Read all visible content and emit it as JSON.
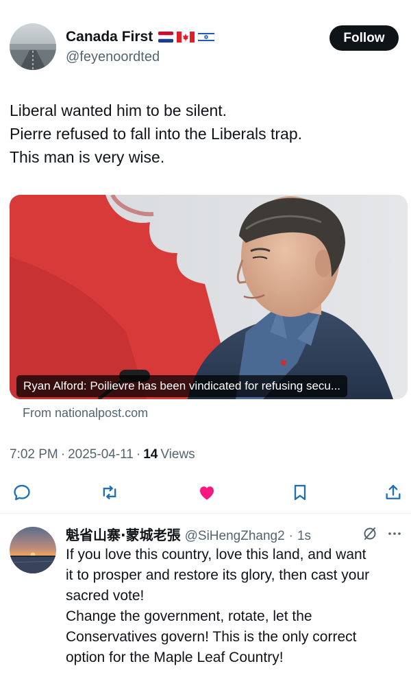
{
  "tweet": {
    "display_name": "Canada First",
    "flag_icons": [
      "netherlands-flag-icon",
      "canada-flag-icon",
      "israel-flag-icon"
    ],
    "handle": "@feyenoordted",
    "follow_label": "Follow",
    "text_lines": [
      "Liberal wanted him to be silent.",
      "Pierre refused to fall into the Liberals trap.",
      "This man is very wise."
    ],
    "card": {
      "caption": "Ryan Alford: Poilievre has been vindicated for refusing secu...",
      "source": "From nationalpost.com"
    },
    "time": "7:02 PM",
    "date": "2025-04-11",
    "views_count": "14",
    "views_label": "Views",
    "liked": true,
    "colors": {
      "like": "#f91880",
      "text": "#0f1419",
      "muted": "#536471"
    }
  },
  "reply": {
    "display_name": "魁省山寨·蒙城老張",
    "handle": "@SiHengZhang2",
    "time": "1s",
    "text_lines": [
      "If you love this country, love this land, and want",
      "it to prosper and restore its glory, then cast your",
      "sacred vote!",
      "Change the government, rotate, let the",
      "Conservatives govern! This is the only correct",
      "option for the Maple Leaf Country!"
    ]
  }
}
